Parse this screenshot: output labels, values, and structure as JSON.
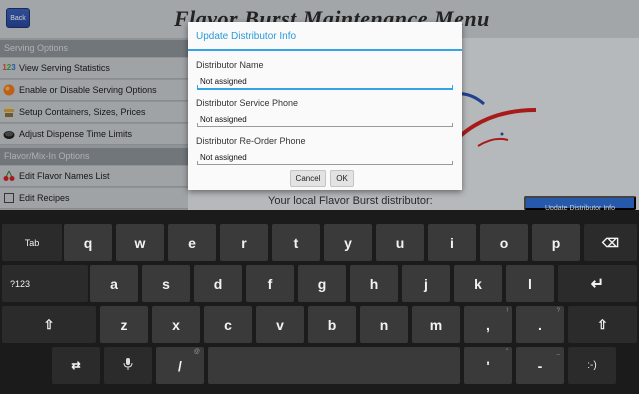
{
  "topbar": {
    "back_label": "Back",
    "title": "Flavor Burst Maintenance Menu"
  },
  "left_panel": {
    "serving_header": "Serving Options",
    "items": [
      {
        "label": "View Serving Statistics",
        "icon": "123"
      },
      {
        "label": "Enable or Disable Serving Options",
        "icon": "flavor-ball-icon"
      },
      {
        "label": "Setup Containers, Sizes, Prices",
        "icon": "containers-icon"
      },
      {
        "label": "Adjust Dispense Time Limits",
        "icon": "timer-icon"
      }
    ],
    "flavor_header": "Flavor/Mix-In Options",
    "flavor_items": [
      {
        "label": "Edit Flavor Names List",
        "icon": "cherry-icon"
      },
      {
        "label": "Edit Recipes",
        "icon": "recipe-icon"
      }
    ]
  },
  "right_panel": {
    "distributor_text": "Your local Flavor Burst distributor:",
    "update_button_label": "Update Distributor Info"
  },
  "dialog": {
    "title": "Update Distributor Info",
    "fields": [
      {
        "label": "Distributor Name",
        "value": "Not assigned"
      },
      {
        "label": "Distributor Service Phone",
        "value": "Not assigned"
      },
      {
        "label": "Distributor Re-Order Phone",
        "value": "Not assigned"
      }
    ],
    "cancel_label": "Cancel",
    "ok_label": "OK"
  },
  "keyboard": {
    "row1": [
      "Tab",
      "q",
      "w",
      "e",
      "r",
      "t",
      "y",
      "u",
      "i",
      "o",
      "p",
      "⌫"
    ],
    "row2": [
      "?123",
      "a",
      "s",
      "d",
      "f",
      "g",
      "h",
      "j",
      "k",
      "l",
      "↵"
    ],
    "row3": [
      "⇧",
      "z",
      "x",
      "c",
      "v",
      "b",
      "n",
      "m",
      ",",
      ".",
      "⇧"
    ],
    "row3_hints": {
      "comma": "!",
      "period": "?"
    },
    "row4": [
      "⇄",
      "🎤",
      "/",
      "",
      "'",
      "-",
      ":-)"
    ],
    "row4_hints": {
      "slash": "@",
      "quote": "\"",
      "dash": "_"
    }
  },
  "colors": {
    "accent": "#33a5e5",
    "keyboard_bg": "#1b1b1b",
    "key_bg": "#3a3a3a"
  }
}
